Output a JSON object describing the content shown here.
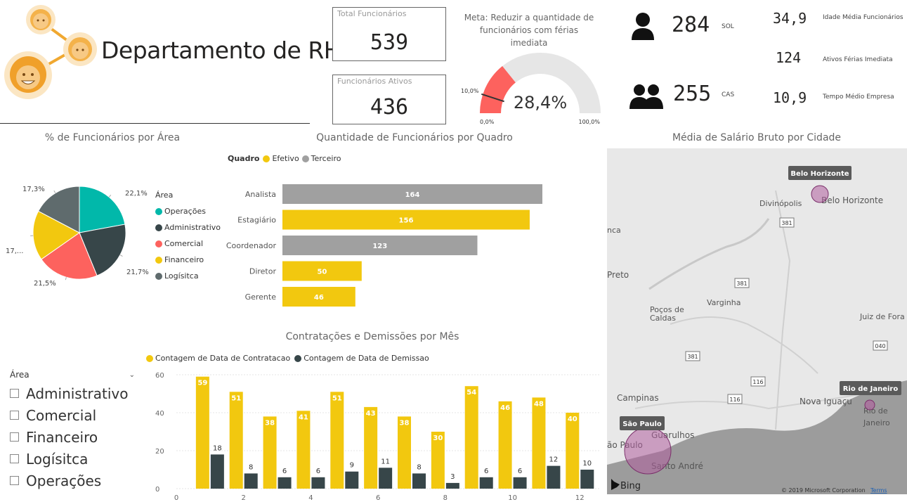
{
  "header": {
    "title": "Departamento de RH"
  },
  "cards": {
    "total": {
      "label": "Total Funcionários",
      "value": "539"
    },
    "ativos": {
      "label": "Funcionários Ativos",
      "value": "436"
    }
  },
  "gauge": {
    "title": "Meta: Reduzir a quantidade de funcionários com férias imediata",
    "value_label": "28,4%",
    "value": 0.284,
    "target_label": "10,0%",
    "target": 0.1,
    "min_label": "0,0%",
    "max_label": "100,0%",
    "fill_color": "#fd625e",
    "track_color": "#e6e6e6"
  },
  "kpis": {
    "sol": {
      "value": "284",
      "label": "SOL",
      "icon": "person-icon"
    },
    "cas": {
      "value": "255",
      "label": "CAS",
      "icon": "people-icon"
    },
    "idade": {
      "value": "34,9",
      "label": "Idade Média Funcionários"
    },
    "ferias": {
      "value": "124",
      "label": "Ativos Férias Imediata"
    },
    "tempo": {
      "value": "10,9",
      "label": "Tempo Médio Empresa"
    }
  },
  "pie_title": "% de Funcionários por Área",
  "bar_title": "Quantidade de Funcionários por Quadro",
  "combo_title": "Contratações e Demissões por Mês",
  "map_title": "Média de Salário Bruto por Cidade",
  "slicer": {
    "title": "Área",
    "items": [
      "Administrativo",
      "Comercial",
      "Financeiro",
      "Logísitca",
      "Operações"
    ]
  },
  "chart_data": [
    {
      "type": "pie",
      "title": "% de Funcionários por Área",
      "legend_title": "Área",
      "legend_position": "right",
      "categories": [
        "Operações",
        "Administrativo",
        "Comercial",
        "Financeiro",
        "Logísitca"
      ],
      "values": [
        22.1,
        21.7,
        21.5,
        17.4,
        17.3
      ],
      "labels": [
        "22,1%",
        "21,7%",
        "21,5%",
        "17,...",
        "17,3%"
      ],
      "colors": [
        "#01b8aa",
        "#374649",
        "#fd625e",
        "#f2c80f",
        "#5f6b6d"
      ]
    },
    {
      "type": "bar",
      "orientation": "horizontal",
      "title": "Quantidade de Funcionários por Quadro",
      "legend_title": "Quadro",
      "legend_position": "top-left",
      "legend": [
        {
          "name": "Efetivo",
          "color": "#f2c80f"
        },
        {
          "name": "Terceiro",
          "color": "#a0a0a0"
        }
      ],
      "categories": [
        "Analista",
        "Estagiário",
        "Coordenador",
        "Diretor",
        "Gerente"
      ],
      "values": [
        164,
        156,
        123,
        50,
        46
      ],
      "series_of_bar": [
        "Terceiro",
        "Efetivo",
        "Terceiro",
        "Efetivo",
        "Efetivo"
      ]
    },
    {
      "type": "bar",
      "title": "Contratações e Demissões por Mês",
      "legend_position": "top-left",
      "x": [
        1,
        2,
        3,
        4,
        5,
        6,
        7,
        8,
        9,
        10,
        11,
        12
      ],
      "xticks": [
        "0",
        "2",
        "4",
        "6",
        "8",
        "10",
        "12"
      ],
      "yticks": [
        "0",
        "20",
        "40",
        "60"
      ],
      "ylim": [
        0,
        60
      ],
      "grid": true,
      "series": [
        {
          "name": "Contagem de Data de Contratacao",
          "color": "#f2c80f",
          "values": [
            59,
            51,
            38,
            41,
            51,
            43,
            38,
            30,
            54,
            46,
            48,
            40
          ]
        },
        {
          "name": "Contagem de Data de Demissao",
          "color": "#374649",
          "values": [
            18,
            8,
            6,
            6,
            9,
            11,
            8,
            3,
            6,
            6,
            12,
            10
          ]
        }
      ]
    }
  ],
  "map": {
    "provider": "Bing",
    "copyright": "© 2019 Microsoft Corporation",
    "terms": "Terms",
    "bubble_color": "#b05e9e",
    "cities": [
      {
        "name": "Belo Horizonte",
        "size": "small"
      },
      {
        "name": "Rio de Janeiro",
        "size": "small"
      },
      {
        "name": "São Paulo",
        "size": "large"
      }
    ],
    "places": [
      "Belo Horizonte",
      "Divinópolis",
      "Preto",
      "Poços de",
      "Caldas",
      "Varginha",
      "Juiz de Fora",
      "Campinas",
      "Nova Iguaçu",
      "Rio de",
      "Janeiro",
      "ão Paulo",
      "Guarulhos",
      "Santo André",
      "nca"
    ],
    "roads": [
      "381",
      "381",
      "381",
      "116",
      "116",
      "040"
    ]
  }
}
